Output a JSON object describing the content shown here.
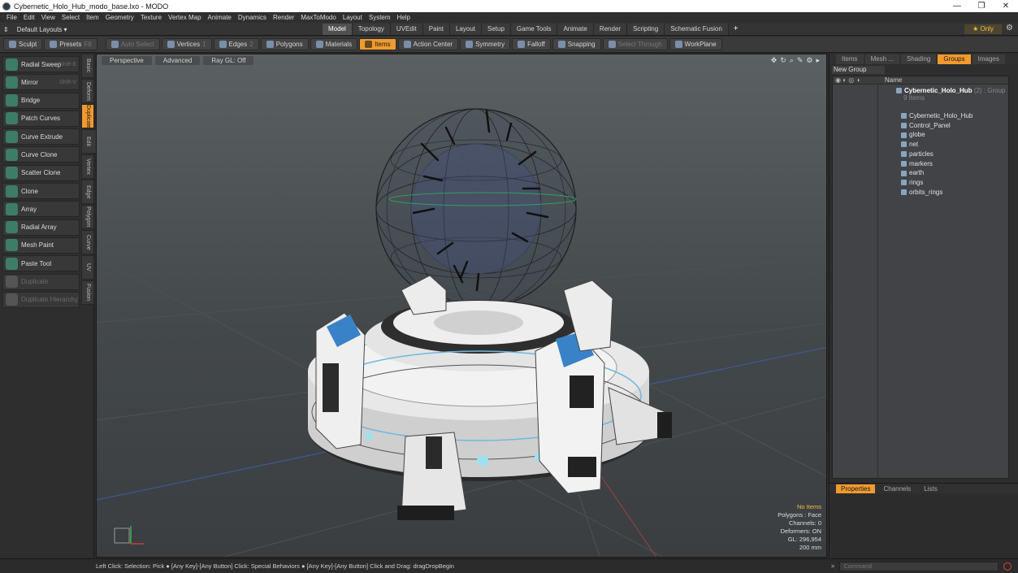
{
  "window": {
    "title": "Cybernetic_Holo_Hub_modo_base.lxo - MODO",
    "controls": [
      "—",
      "❐",
      "✕"
    ]
  },
  "menu": [
    "File",
    "Edit",
    "View",
    "Select",
    "Item",
    "Geometry",
    "Texture",
    "Vertex Map",
    "Animate",
    "Dynamics",
    "Render",
    "MaxToModo",
    "Layout",
    "System",
    "Help"
  ],
  "layout_bar": {
    "layout_label": "Default Layouts ▾",
    "tabs": [
      "Model",
      "Topology",
      "UVEdit",
      "Paint",
      "Layout",
      "Setup",
      "Game Tools",
      "Animate",
      "Render",
      "Scripting",
      "Schematic Fusion"
    ],
    "active_tab": "Model",
    "plus": "+",
    "only_label": "★ Only"
  },
  "toolbar": {
    "sculpt": "Sculpt",
    "presets": "Presets",
    "presets_key": "F6",
    "auto_select": "Auto Select",
    "vertices": "Vertices",
    "vertices_key": "1",
    "edges": "Edges",
    "edges_key": "2",
    "polygons": "Polygons",
    "materials": "Materials",
    "items": "Items",
    "action_center": "Action Center",
    "symmetry": "Symmetry",
    "falloff": "Falloff",
    "snapping": "Snapping",
    "select_through": "Select Through",
    "workplane": "WorkPlane"
  },
  "left_tools": [
    {
      "label": "Radial Sweep",
      "shortcut": "Shift-E",
      "enabled": true
    },
    {
      "label": "Mirror",
      "shortcut": "Shift-V",
      "enabled": true
    },
    {
      "label": "Bridge",
      "shortcut": "",
      "enabled": true
    },
    {
      "label": "Patch Curves",
      "shortcut": "",
      "enabled": true
    },
    {
      "label": "Curve Extrude",
      "shortcut": "",
      "enabled": true
    },
    {
      "label": "Curve Clone",
      "shortcut": "",
      "enabled": true
    },
    {
      "label": "Scatter Clone",
      "shortcut": "",
      "enabled": true
    },
    {
      "label": "Clone",
      "shortcut": "",
      "enabled": true
    },
    {
      "label": "Array",
      "shortcut": "",
      "enabled": true
    },
    {
      "label": "Radial Array",
      "shortcut": "",
      "enabled": true
    },
    {
      "label": "Mesh Paint",
      "shortcut": "",
      "enabled": true
    },
    {
      "label": "Paste Tool",
      "shortcut": "",
      "enabled": true
    },
    {
      "label": "Duplicate",
      "shortcut": "",
      "enabled": false
    },
    {
      "label": "Duplicate Hierarchy",
      "shortcut": "",
      "enabled": false
    }
  ],
  "vertical_tabs": [
    "Basic",
    "Deform",
    "Duplicate",
    "Mesh Edit",
    "Vertex",
    "Edge",
    "Polygon",
    "Curve",
    "UV",
    "Fusion"
  ],
  "active_vertical_tab": "Duplicate",
  "viewport": {
    "tabs": [
      "Perspective",
      "Advanced",
      "Ray GL: Off"
    ],
    "info": {
      "no_items": "No Items",
      "polygons": "Polygons : Face",
      "channels": "Channels: 0",
      "deformers": "Deformers: ON",
      "gl": "GL: 296,954",
      "scale": "200 mm"
    }
  },
  "right_panel": {
    "tabs": [
      "Items",
      "Mesh ...",
      "Shading",
      "Groups",
      "Images"
    ],
    "active_tab": "Groups",
    "new_group": "New Group",
    "column_header": "Name",
    "group": {
      "name": "Cybernetic_Holo_Hub",
      "meta": "(2) : Group",
      "count": "9 Items"
    },
    "children": [
      "Cybernetic_Holo_Hub",
      "Control_Panel",
      "globe",
      "net",
      "particles",
      "markers",
      "earth",
      "rings",
      "orbits_rings"
    ],
    "bottom_tabs": [
      "Properties",
      "Channels",
      "Lists"
    ],
    "active_bottom_tab": "Properties"
  },
  "status": {
    "text": "Left Click: Selection: Pick ● [Any Key]-[Any Button] Click: Special Behaviors ● [Any Key]-[Any Button] Click and Drag: dragDropBegin",
    "command_placeholder": "Command"
  }
}
